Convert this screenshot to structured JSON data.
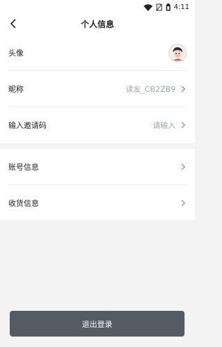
{
  "status_bar": {
    "time": "4:11"
  },
  "header": {
    "title": "个人信息"
  },
  "profile": {
    "avatar_label": "头像",
    "nickname_label": "昵称",
    "nickname_value": "读友_CB2ZB9",
    "invite_label": "输入邀请码",
    "invite_placeholder": "请输入"
  },
  "account": {
    "account_info_label": "账号信息",
    "shipping_info_label": "收货信息"
  },
  "logout_label": "退出登录",
  "colors": {
    "background": "#f3f3f3",
    "row_background": "#ffffff",
    "logout_button": "#555b63",
    "secondary_text": "#a0a4ab"
  },
  "icons": [
    "wifi-icon",
    "no-sim-icon",
    "battery-icon",
    "back-arrow-icon",
    "chevron-right-icon"
  ]
}
